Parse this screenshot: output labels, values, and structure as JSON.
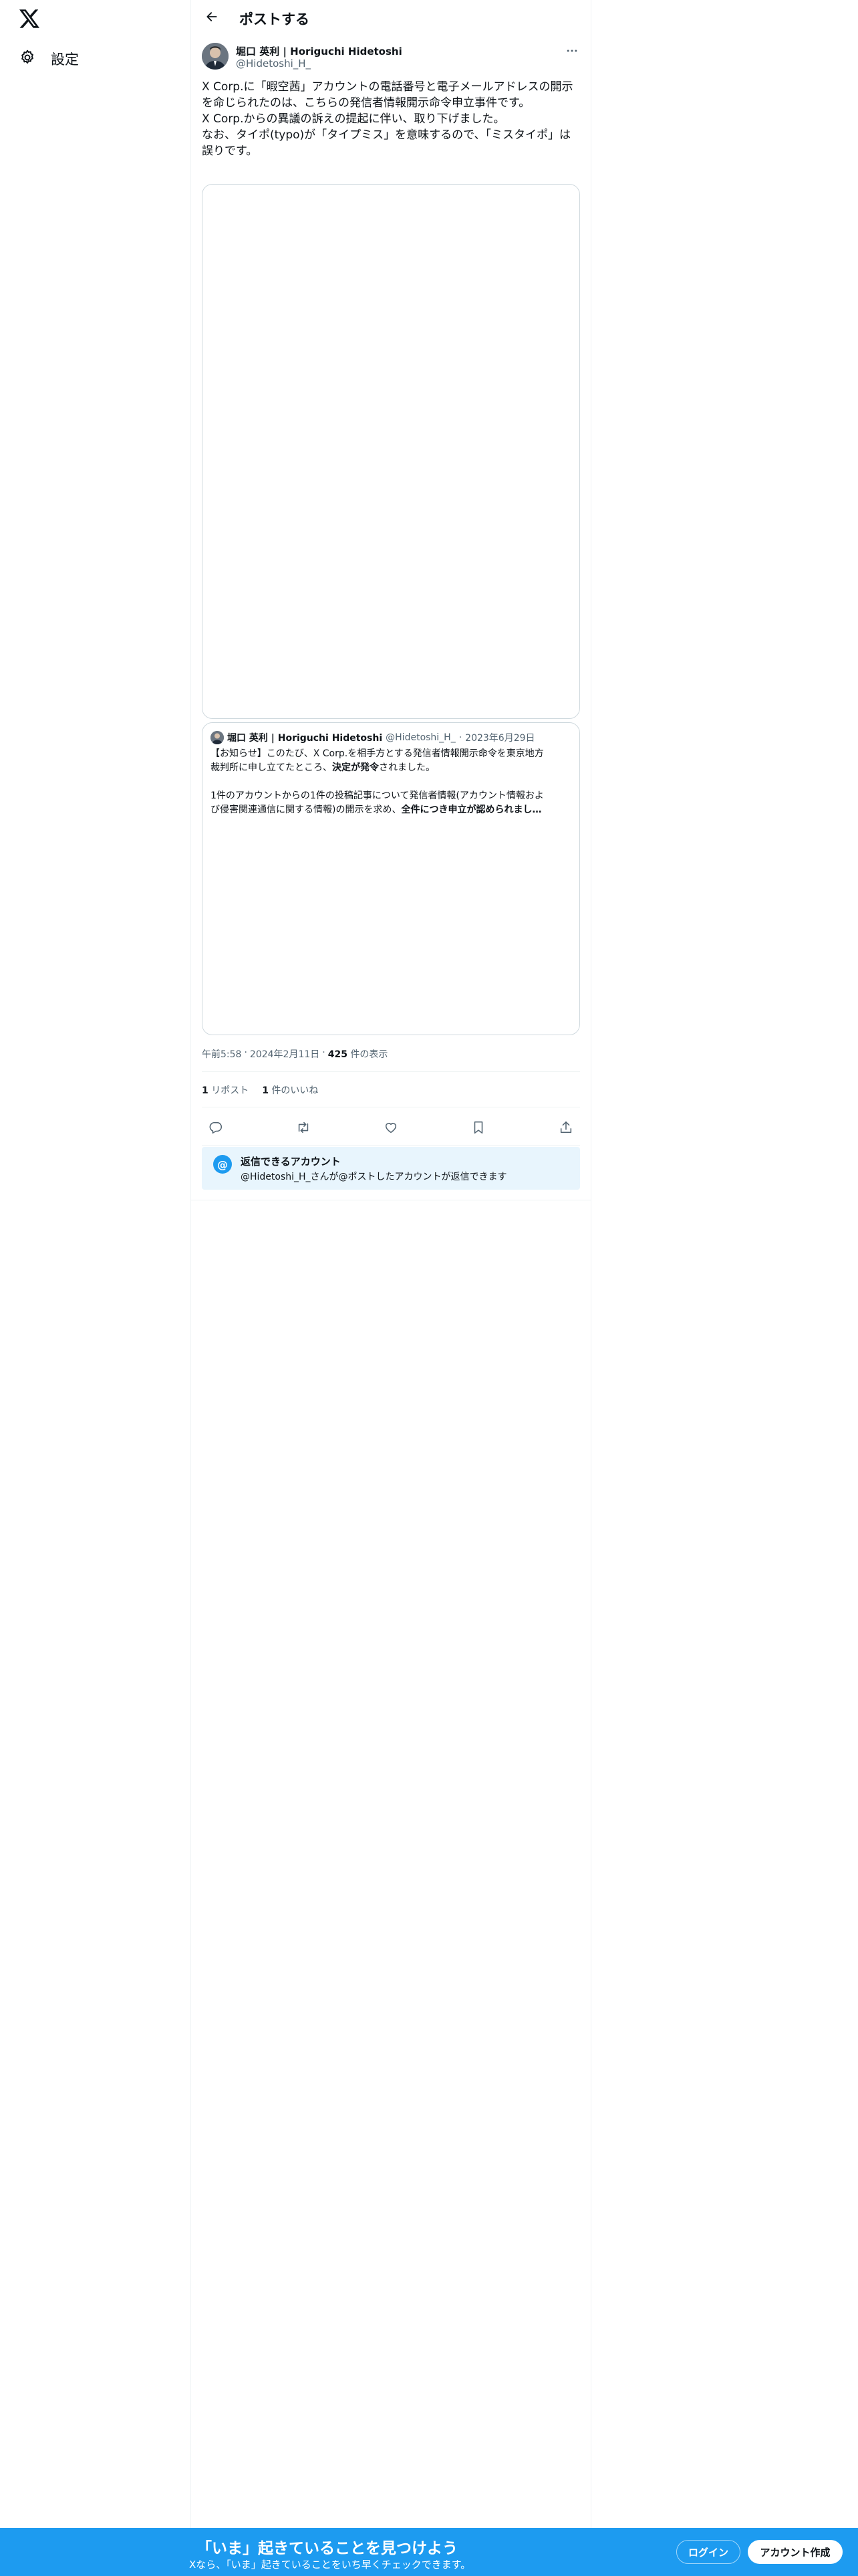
{
  "nav": {
    "settings_label": "設定"
  },
  "header": {
    "title": "ポストする"
  },
  "post": {
    "author_name": "堀口 英利 | Horiguchi Hidetoshi",
    "author_handle": "@Hidetoshi_H_",
    "text": [
      "X Corp.に「暇空茜」アカウントの電話番号と電子メールアドレスの開示",
      "を命じられたのは、こちらの発信者情報開示命令申立事件です。",
      "X Corp.からの異議の訴えの提起に伴い、取り下げました。",
      "",
      "なお、タイポ(typo)が「タイプミス」を意味するので、「ミスタイポ」は",
      "誤りです。"
    ],
    "time": "午前5:58",
    "date": "2024年2月11日",
    "views_count": "425",
    "views_label": "件の表示",
    "reposts_count": "1",
    "reposts_label": "リポスト",
    "likes_count": "1",
    "likes_label": "件のいいね",
    "separator": "·"
  },
  "quote": {
    "author_name": "堀口 英利 | Horiguchi Hidetoshi",
    "author_handle": "@Hidetoshi_H_",
    "separator": "·",
    "date": "2023年6月29日",
    "line1_pre": "【お知らせ】このたび、X Corp.を相手方とする発信者情報開示命令を東京地方",
    "line2_pre": "裁判所に申し立てたところ、",
    "line2_bold": "決定が発令",
    "line2_post": "されました。",
    "line4": "1件のアカウントからの1件の投稿記事について発信者情報(アカウント情報およ",
    "line5_pre": "び侵害関連通信に関する情報)の開示を求め、",
    "line5_bold": "全件につき申立が認められまし…"
  },
  "reply_restriction": {
    "title": "返信できるアカウント",
    "description": "@Hidetoshi_H_さんが@ポストしたアカウントが返信できます",
    "icon_glyph": "@"
  },
  "bottom_bar": {
    "title": "「いま」起きていることを見つけよう",
    "subtitle": "Xなら、「いま」起きていることをいち早くチェックできます。",
    "login_label": "ログイン",
    "signup_label": "アカウント作成"
  },
  "icons": {
    "logo": "x-logo-icon",
    "settings": "gear-icon",
    "back": "arrow-left-icon",
    "more": "more-horizontal-icon",
    "reply": "comment-icon",
    "repost": "repost-icon",
    "like": "heart-icon",
    "bookmark": "bookmark-icon",
    "share": "share-icon"
  },
  "colors": {
    "accent": "#1d9bf0",
    "text": "#0f1419",
    "secondary": "#536471",
    "reply_box_bg": "#e8f5fd",
    "border": "#cfd9de"
  }
}
